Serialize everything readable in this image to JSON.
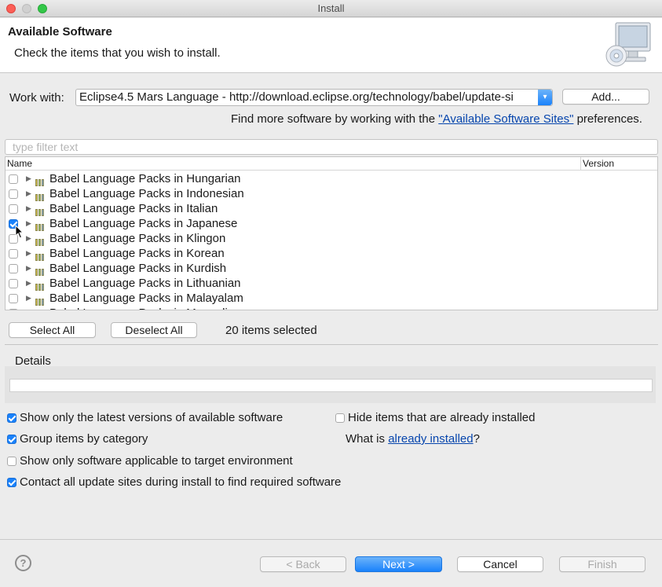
{
  "window": {
    "title": "Install"
  },
  "header": {
    "title": "Available Software",
    "subtitle": "Check the items that you wish to install."
  },
  "work_with": {
    "label": "Work with:",
    "value": "Eclipse4.5 Mars Language - http://download.eclipse.org/technology/babel/update-si",
    "add_label": "Add..."
  },
  "more_sites": {
    "prefix": "Find more software by working with the ",
    "link": "\"Available Software Sites\"",
    "suffix": " preferences."
  },
  "filter": {
    "placeholder": "type filter text"
  },
  "table": {
    "columns": [
      "Name",
      "Version"
    ],
    "rows": [
      {
        "name": "Babel Language Packs in Hungarian",
        "checked": false
      },
      {
        "name": "Babel Language Packs in Indonesian",
        "checked": false
      },
      {
        "name": "Babel Language Packs in Italian",
        "checked": false
      },
      {
        "name": "Babel Language Packs in Japanese",
        "checked": true
      },
      {
        "name": "Babel Language Packs in Klingon",
        "checked": false
      },
      {
        "name": "Babel Language Packs in Korean",
        "checked": false
      },
      {
        "name": "Babel Language Packs in Kurdish",
        "checked": false
      },
      {
        "name": "Babel Language Packs in Lithuanian",
        "checked": false
      },
      {
        "name": "Babel Language Packs in Malayalam",
        "checked": false
      },
      {
        "name": "Babel Language Packs in Mongolian",
        "checked": false
      }
    ]
  },
  "selection": {
    "select_all": "Select All",
    "deselect_all": "Deselect All",
    "count": "20 items selected"
  },
  "details": {
    "title": "Details"
  },
  "options": {
    "latest_versions": {
      "label": "Show only the latest versions of available software",
      "checked": true
    },
    "group_by_category": {
      "label": "Group items by category",
      "checked": true
    },
    "target_env": {
      "label": "Show only software applicable to target environment",
      "checked": false
    },
    "contact_sites": {
      "label": "Contact all update sites during install to find required software",
      "checked": true
    },
    "hide_installed": {
      "label": "Hide items that are already installed",
      "checked": false
    },
    "what_is": {
      "prefix": "What is ",
      "link": "already installed",
      "suffix": "?"
    }
  },
  "footer": {
    "help_icon": "?",
    "back": "< Back",
    "next": "Next >",
    "cancel": "Cancel",
    "finish": "Finish"
  },
  "colors": {
    "accent": "#1a82fb",
    "link": "#0645ad"
  }
}
